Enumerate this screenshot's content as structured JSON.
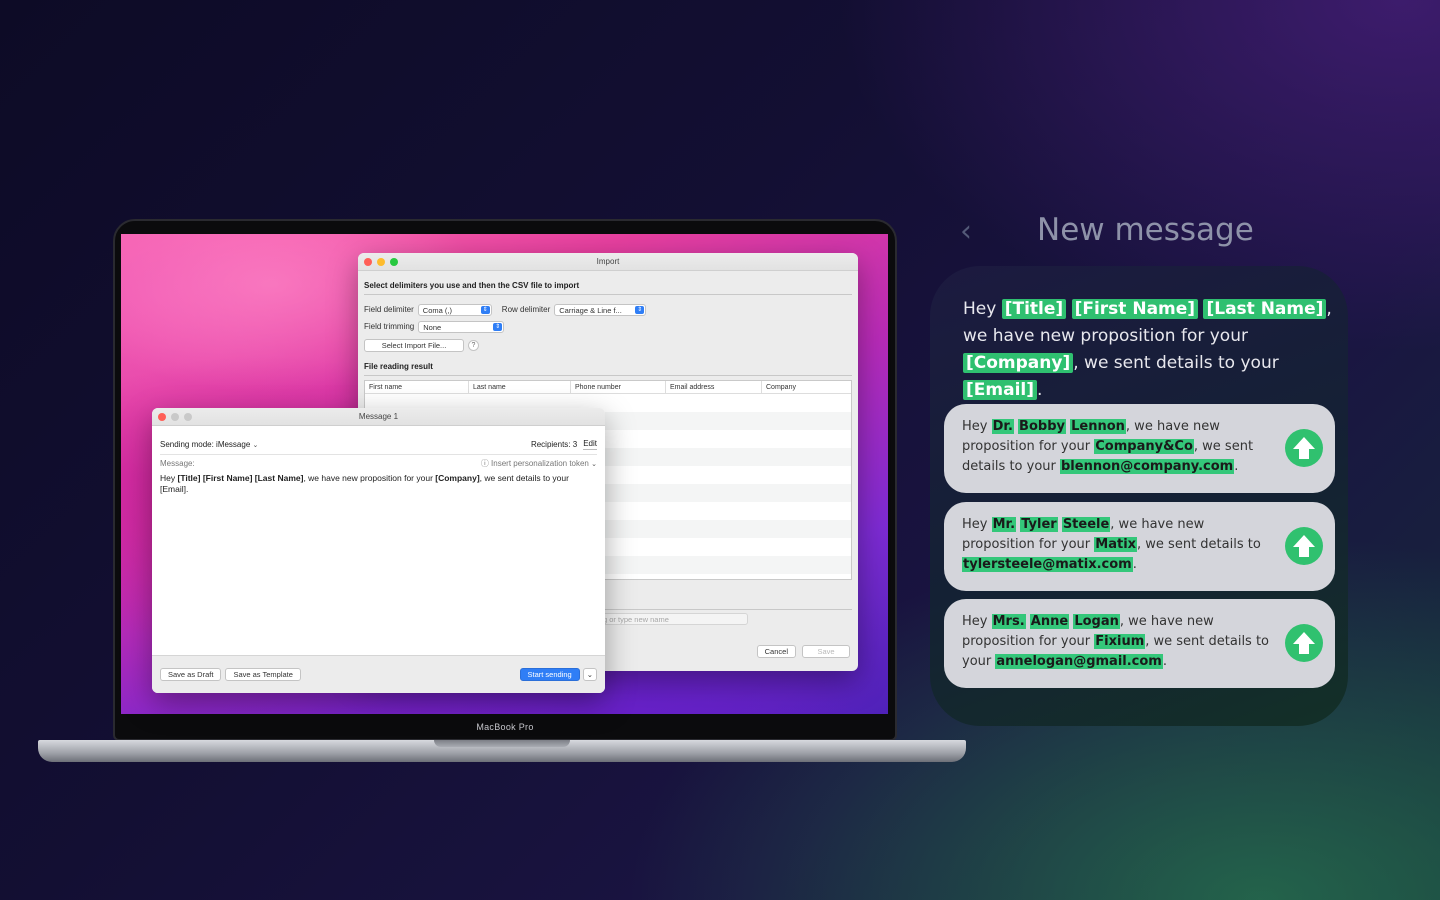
{
  "laptop": {
    "brand": "MacBook Pro"
  },
  "import_window": {
    "title": "Import",
    "section_delimiters": "Select delimiters you use and then the CSV file to import",
    "field_delimiter_label": "Field delimiter",
    "field_delimiter_value": "Coma (,)",
    "row_delimiter_label": "Row delimiter",
    "row_delimiter_value": "Carriage & Line f...",
    "field_trimming_label": "Field trimming",
    "field_trimming_value": "None",
    "select_file_button": "Select Import File...",
    "help": "?",
    "section_result": "File reading result",
    "columns": [
      "First name",
      "Last name",
      "Phone number",
      "Email address",
      "Company"
    ],
    "name_placeholder": "g or type new name",
    "cancel_button": "Cancel",
    "save_button": "Save"
  },
  "message_window": {
    "title": "Message 1",
    "sending_mode": "Sending mode: iMessage",
    "recipients": "Recipients: 3",
    "edit_button": "Edit",
    "message_label": "Message:",
    "insert_token": "Insert personalization token",
    "body_parts": {
      "p1": "Hey ",
      "t1": "[Title] [First Name] [Last Name]",
      "p2": ", we have new proposition for your ",
      "t2": "[Company]",
      "p3": ", we sent details to your [Email]."
    },
    "save_draft_button": "Save as Draft",
    "save_template_button": "Save as Template",
    "start_sending_button": "Start sending"
  },
  "new_message": {
    "title": "New message",
    "back_icon": "chevron-left-icon",
    "template": {
      "p1": "Hey ",
      "title": "[Title]",
      "first": "[First Name]",
      "last": "[Last Name]",
      "p2": ", we have new proposition for your ",
      "company": "[Company]",
      "p3": ", we sent details to your ",
      "email": "[Email]",
      "p4": "."
    },
    "messages": [
      {
        "hey": "Hey ",
        "title": "Dr.",
        "first": "Bobby",
        "last": "Lennon",
        "mid": ", we have new proposition for your ",
        "company": "Company&Co",
        "mid2": ", we sent details to your ",
        "email": "blennon@company.com",
        "end": "."
      },
      {
        "hey": "Hey ",
        "title": "Mr.",
        "first": "Tyler",
        "last": "Steele",
        "mid": ", we have new proposition for your ",
        "company": "Matix",
        "mid2": ", we sent details to ",
        "email": "tylersteele@matix.com",
        "end": "."
      },
      {
        "hey": "Hey ",
        "title": "Mrs.",
        "first": "Anne",
        "last": "Logan",
        "mid": ", we have new proposition for your ",
        "company": "Fixium",
        "mid2": ", we sent details to your ",
        "email": "annelogan@gmail.com",
        "end": "."
      }
    ],
    "colors": {
      "token": "#2fc070",
      "send_button": "#30c16f"
    }
  }
}
